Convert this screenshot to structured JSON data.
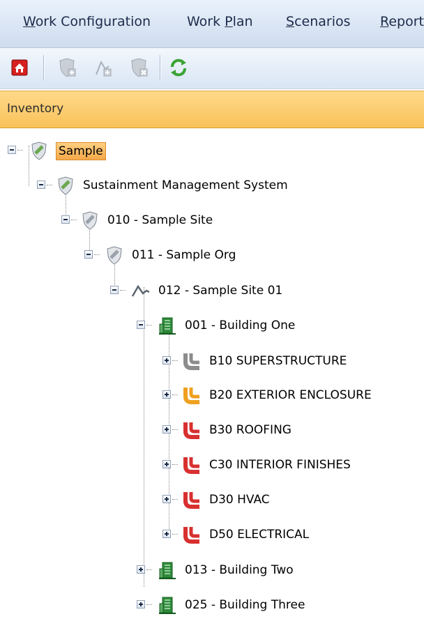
{
  "menu": {
    "items": [
      {
        "pre": "",
        "u": "W",
        "post": "ork Configuration"
      },
      {
        "pre": "Work ",
        "u": "P",
        "post": "lan"
      },
      {
        "pre": "",
        "u": "S",
        "post": "cenarios"
      },
      {
        "pre": "",
        "u": "R",
        "post": "eport"
      }
    ]
  },
  "toolbar": {
    "buttons": [
      {
        "icon": "home-icon",
        "enabled": true
      },
      {
        "icon": "shield-add-icon",
        "enabled": false
      },
      {
        "icon": "flag-add-icon",
        "enabled": false
      },
      {
        "icon": "shield-delete-icon",
        "enabled": false
      },
      {
        "icon": "refresh-icon",
        "enabled": true
      }
    ]
  },
  "panel": {
    "title": "Inventory"
  },
  "tree": {
    "nodes": [
      {
        "label": "Sample",
        "icon": "shield-icon",
        "expanded": true,
        "selected": true
      },
      {
        "label": "Sustainment Management System",
        "icon": "shield-icon",
        "expanded": true
      },
      {
        "label": "010 - Sample Site",
        "icon": "shield-gray-icon",
        "expanded": true
      },
      {
        "label": "011 - Sample Org",
        "icon": "shield-gray-icon",
        "expanded": true
      },
      {
        "label": "012 - Sample Site 01",
        "icon": "flag-icon",
        "expanded": true
      },
      {
        "label": "001 - Building One",
        "icon": "building-icon",
        "expanded": true
      },
      {
        "label": "B10 SUPERSTRUCTURE",
        "icon": "pipe-gray-icon",
        "expanded": false
      },
      {
        "label": "B20 EXTERIOR ENCLOSURE",
        "icon": "pipe-orange-icon",
        "expanded": false
      },
      {
        "label": "B30 ROOFING",
        "icon": "pipe-red-icon",
        "expanded": false
      },
      {
        "label": "C30 INTERIOR FINISHES",
        "icon": "pipe-red-icon",
        "expanded": false
      },
      {
        "label": "D30 HVAC",
        "icon": "pipe-red-icon",
        "expanded": false
      },
      {
        "label": "D50 ELECTRICAL",
        "icon": "pipe-red-icon",
        "expanded": false
      },
      {
        "label": "013 - Building Two",
        "icon": "building-icon",
        "expanded": false
      },
      {
        "label": "025 - Building Three",
        "icon": "building-icon",
        "expanded": false
      }
    ]
  },
  "colors": {
    "pipe_gray": "#8c8c8c",
    "pipe_orange": "#f0a020",
    "pipe_red": "#d83030",
    "shield_green": "#6aa84f",
    "building_green": "#2e8b3a",
    "selected_bg": "#f5a84a"
  }
}
